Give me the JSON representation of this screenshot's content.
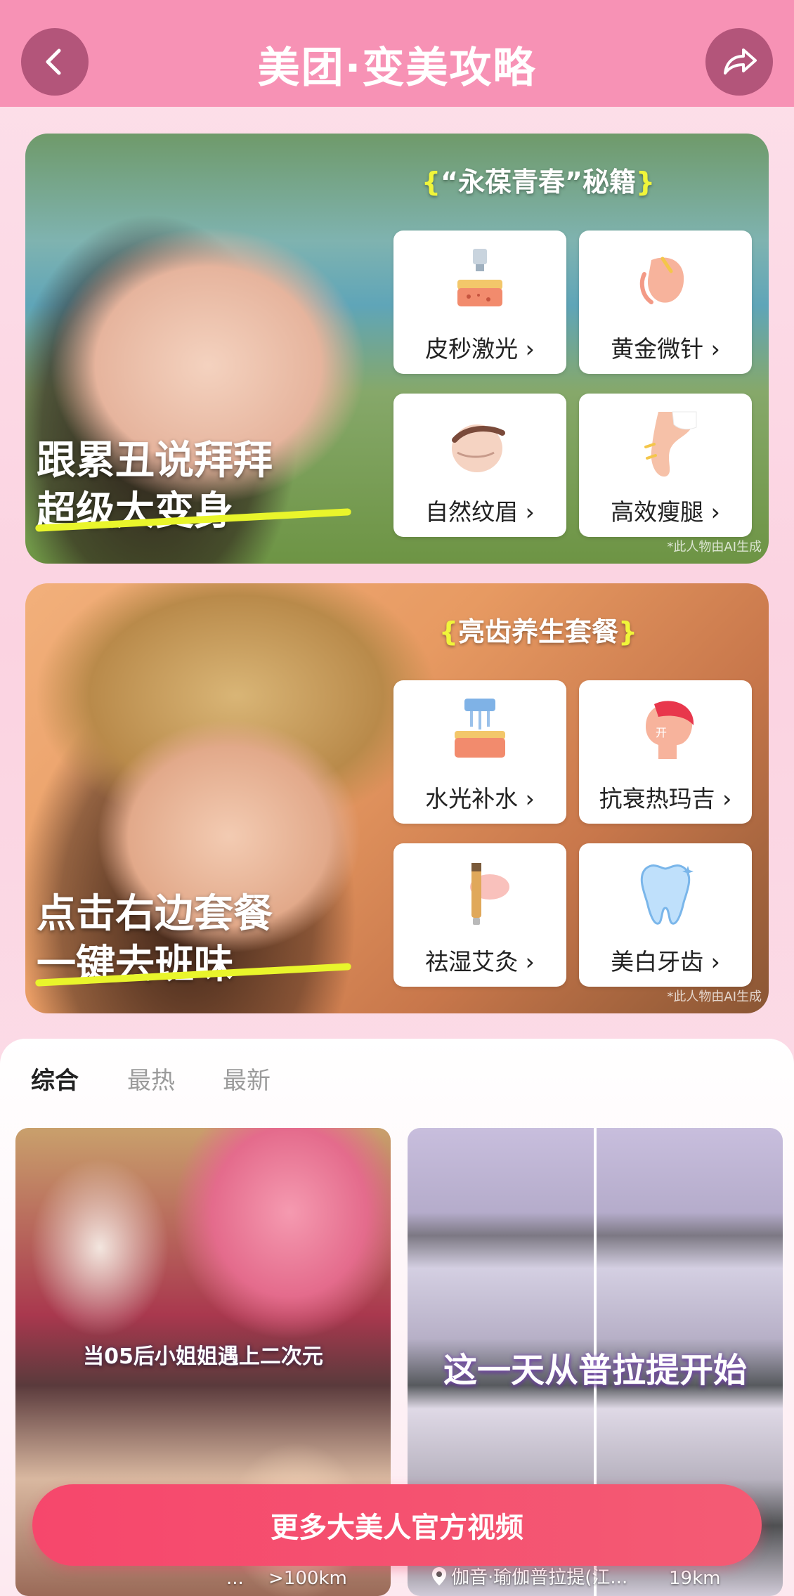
{
  "header": {
    "title": "美团·变美攻略",
    "background": "#f792b5"
  },
  "banners": [
    {
      "caption_line1": "跟累丑说拜拜",
      "caption_line2": "超级大变身",
      "kit_title": "“永葆青春”秘籍",
      "ai_note": "*此人物由AI生成",
      "tiles": [
        {
          "label": "皮秒激光 ›",
          "icon": "laser-device-icon"
        },
        {
          "label": "黄金微针 ›",
          "icon": "face-microneedle-icon"
        },
        {
          "label": "自然纹眉 ›",
          "icon": "eyebrow-icon"
        },
        {
          "label": "高效瘦腿 ›",
          "icon": "leg-slimming-icon"
        }
      ]
    },
    {
      "caption_line1": "点击右边套餐",
      "caption_line2": "一键去班味",
      "kit_title": "亮齿养生套餐",
      "ai_note": "*此人物由AI生成",
      "tiles": [
        {
          "label": "水光补水 ›",
          "icon": "hydration-device-icon"
        },
        {
          "label": "抗衰热玛吉 ›",
          "icon": "thermage-face-icon"
        },
        {
          "label": "祛湿艾灸 ›",
          "icon": "moxibustion-stick-icon"
        },
        {
          "label": "美白牙齿 ›",
          "icon": "tooth-whitening-icon"
        }
      ]
    }
  ],
  "feed": {
    "tabs": [
      {
        "label": "综合",
        "active": true
      },
      {
        "label": "最热",
        "active": false
      },
      {
        "label": "最新",
        "active": false
      }
    ],
    "videos": [
      {
        "overlay": "当05后小姐姐遇上二次元",
        "location": "...",
        "distance": ">100km"
      },
      {
        "overlay": "这一天从普拉提开始",
        "location": "伽音·瑜伽普拉提(江...",
        "distance": "19km"
      }
    ]
  },
  "cta": {
    "label": "更多大美人官方视频",
    "color": "#f6476c"
  }
}
